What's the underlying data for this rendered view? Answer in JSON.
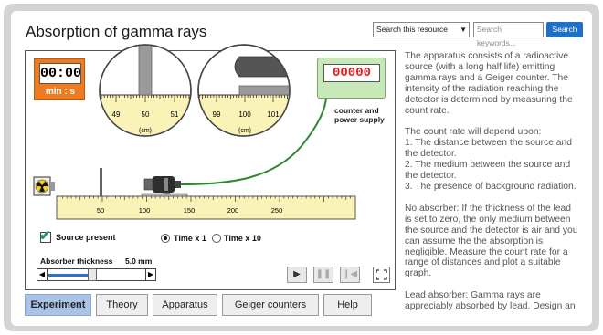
{
  "header": {
    "title": "Absorption of gamma rays",
    "search_select_value": "Search this resource",
    "search_placeholder": "Search keywords...",
    "search_button": "Search"
  },
  "simulation": {
    "timer_display": "00:00",
    "timer_unit": "min : s",
    "counter_display": "00000",
    "counter_label_line1": "counter and",
    "counter_label_line2": "power supply",
    "gauge_left": {
      "ticks": [
        "49",
        "50",
        "51"
      ],
      "unit": "(cm)"
    },
    "gauge_right": {
      "ticks": [
        "99",
        "100",
        "101"
      ],
      "unit": "(cm)"
    },
    "ruler_ticks": [
      "50",
      "100",
      "150",
      "200",
      "250"
    ],
    "source_present_label": "Source present",
    "source_present_checked": true,
    "time_x1_label": "Time x 1",
    "time_x10_label": "Time x 10",
    "time_selected": "x1",
    "absorber_label": "Absorber thickness",
    "absorber_value": "5.0 mm",
    "absorber_fraction": 0.45,
    "colors": {
      "timer": "#f07a1e",
      "counter_panel": "#c8e8b8",
      "counter_digits": "#e02020",
      "slider_fill": "#2a72c9",
      "cable": "#2a8a2a",
      "ruler": "#f9f3b8"
    }
  },
  "tabs": [
    {
      "label": "Experiment",
      "active": true
    },
    {
      "label": "Theory",
      "active": false
    },
    {
      "label": "Apparatus",
      "active": false
    },
    {
      "label": "Geiger counters",
      "active": false
    },
    {
      "label": "Help",
      "active": false
    }
  ],
  "description": {
    "p1": "The apparatus consists of a radioactive source (with a long half life) emitting gamma rays and a Geiger counter. The intensity of the radiation reaching the detector is determined by measuring the count rate.",
    "p2_intro": "The count rate will depend upon:",
    "p2_item1": "1. The distance between the source and the detector.",
    "p2_item2": "2. The medium between the source and the detector.",
    "p2_item3": "3. The presence of background radiation.",
    "p3": "No absorber: If the thickness of the lead is set to zero, the only medium between the source and the detector is air and you can assume the the absorption is negligible. Measure the count rate for a range of distances and plot a suitable graph.",
    "p4": "Lead absorber: Gamma rays are appreciably absorbed by lead. Design an"
  },
  "icons": [
    "radiation-icon",
    "play-icon",
    "pause-icon",
    "reset-icon",
    "fullscreen-icon",
    "chevron-down-icon",
    "arrow-left-icon",
    "arrow-right-icon"
  ]
}
